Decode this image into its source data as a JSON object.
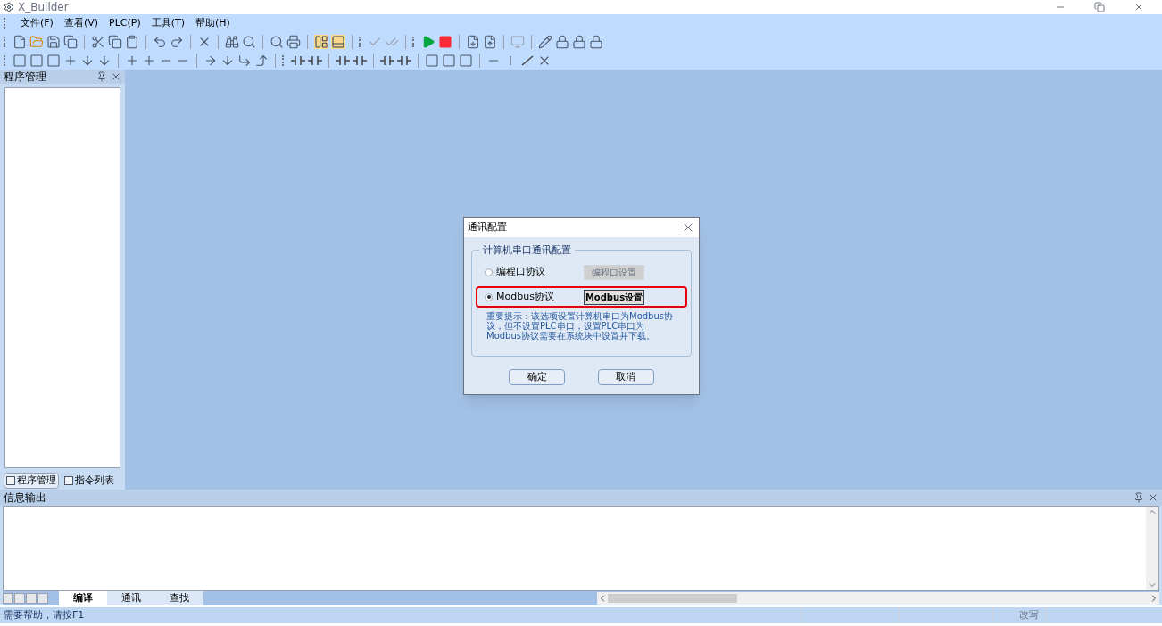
{
  "window": {
    "title": "X_Builder"
  },
  "menu": [
    "文件(F)",
    "查看(V)",
    "PLC(P)",
    "工具(T)",
    "帮助(H)"
  ],
  "left_panel": {
    "title": "程序管理",
    "tabs": [
      {
        "label": "程序管理",
        "selected": true
      },
      {
        "label": "指令列表",
        "selected": false
      }
    ]
  },
  "output_panel": {
    "title": "信息输出",
    "tabs": [
      {
        "label": "编译",
        "selected": true
      },
      {
        "label": "通讯",
        "selected": false
      },
      {
        "label": "查找",
        "selected": false
      }
    ]
  },
  "status_bar": {
    "help": "需要帮助，请按F1",
    "mode": "改写"
  },
  "dialog": {
    "title": "通讯配置",
    "group": "计算机串口通讯配置",
    "options": [
      {
        "label": "编程口协议",
        "selected": false,
        "button": "编程口设置",
        "button_disabled": true,
        "highlighted": false
      },
      {
        "label": "Modbus协议",
        "selected": true,
        "button": "Modbus设置",
        "button_disabled": false,
        "highlighted": true
      }
    ],
    "note": "重要提示：该选项设置计算机串口为Modbus协议，但不设置PLC串口，设置PLC串口为Modbus协议需要在系统块中设置并下载。",
    "buttons": [
      "确定",
      "取消"
    ]
  }
}
